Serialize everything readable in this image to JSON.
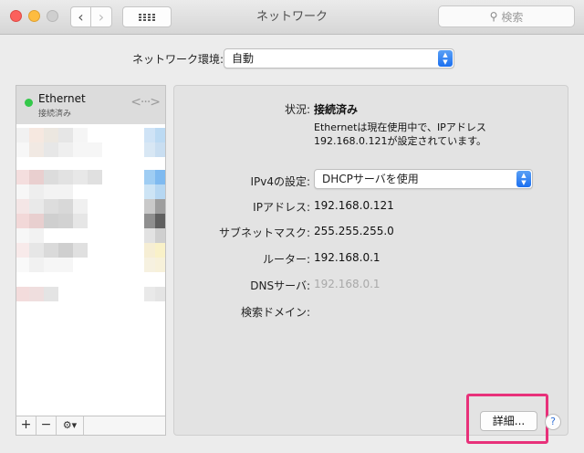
{
  "window": {
    "title": "ネットワーク",
    "search_placeholder": "検索"
  },
  "toolbar": {
    "back_icon": "chevron-left-icon",
    "forward_icon": "chevron-right-icon",
    "grid_icon": "grid-icon"
  },
  "location": {
    "label": "ネットワーク環境:",
    "value": "自動"
  },
  "sidebar": {
    "service": {
      "name": "Ethernet",
      "status": "接続済み",
      "status_color": "#34c84a"
    },
    "buttons": {
      "add": "+",
      "remove": "−",
      "gear": "⚙▾"
    }
  },
  "detail": {
    "status_label": "状況:",
    "status_value": "接続済み",
    "status_desc_line1": "Ethernetは現在使用中で、IPアドレス",
    "status_desc_line2": "192.168.0.121が設定されています。",
    "ipv4_label": "IPv4の設定:",
    "ipv4_value": "DHCPサーバを使用",
    "ip_label": "IPアドレス:",
    "ip_value": "192.168.0.121",
    "subnet_label": "サブネットマスク:",
    "subnet_value": "255.255.255.0",
    "router_label": "ルーター:",
    "router_value": "192.168.0.1",
    "dns_label": "DNSサーバ:",
    "dns_value": "192.168.0.1",
    "search_domain_label": "検索ドメイン:",
    "advanced_button": "詳細...",
    "help_button": "?",
    "highlight_color": "#e8317a"
  }
}
